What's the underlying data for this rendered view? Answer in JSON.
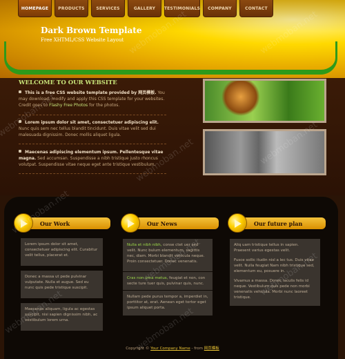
{
  "nav": [
    "HOMEPAGE",
    "PRODUCTS",
    "SERVICES",
    "GALLERY",
    "TESTIMONIALS",
    "COMPANY",
    "CONTACT"
  ],
  "header": {
    "title": "Dark Brown Template",
    "subtitle": "Free XHTML/CSS Website Layout"
  },
  "welcome": {
    "title": "WELCOME TO OUR WEBSITE",
    "p1_lead": "This is a free CSS website template provided by 网页模板.",
    "p1_body": " You may download, modify and apply this CSS template for your websites. Credit goes to",
    "p1_link": "Flashy Free Photos",
    "p1_tail": " for the photos.",
    "p2_lead": "Lorem ipsum dolor sit amet, consectetuer adipiscing elit.",
    "p2_body": " Nunc quis sem nec tellus blandit tincidunt. Duis vitae velit sed dui malesuada dignissim. Donec mollis aliquet ligula.",
    "p3_lead": "Maecenas adipiscing elementum ipsum. Pellentesque vitae magna.",
    "p3_body": " Sed accumsan. Suspendisse a nibh tristique justo rhoncus volutpat. Suspendisse vitae neque eget ante tristique vestibulum."
  },
  "columns": [
    {
      "title": "Our Work",
      "boxes": [
        "Lorem ipsum dolor sit amet, consectetuer adipiscing elit. Curabitur velit tellus, placerat et.",
        "Donec a massa ut pede pulvinar vulputate. Nulla et augue. Sed eu nunc quis pede tristique suscipit.",
        "Maecenas aliquam, ligula ac egestas suscipit, nisi sapien dignissim nibh, ac vestibulum lorem urna."
      ]
    },
    {
      "title": "Our News",
      "b1_lead": "Nulla et nibh nibh,",
      "b1_body": " conse ctet uer sed velit. Nunc bulum elementum, sagittis nec, diam. Morbi blandit vehicula neque. Proin consectetuer. Donec venenatis.",
      "b2_lead": "Cras non urna metus,",
      "b2_body": " feugiat et non, con secte ture tuer quis, pulvinar quis, nunc.",
      "b3": "Nullam pede purus tempor a, imperdiet in, porttitor at, erat. Aenean eget tortor eget ipsum aliquet porta."
    },
    {
      "title": "Our future plan",
      "p1": "Aliq uam tristique tellus in sapien. Praesent varius egestas velit.",
      "p2": "Fusce sollic itudin nisl a lec tus. Duis vitae velit. Nulla feugiat Nam nibh tristique sed, elementum eu, posuere in.",
      "p3": "Vivamus a massa. Donec iaculis felis id neque. Vestibulum quis pede non morbi venenatis vehicula. Morbi nunc laoreet tristique."
    }
  ],
  "footer": {
    "copyright": "Copyright ©",
    "company": "Your Company Name",
    "from": " - from ",
    "site": "网页模板"
  },
  "watermark": "webmoban.net"
}
